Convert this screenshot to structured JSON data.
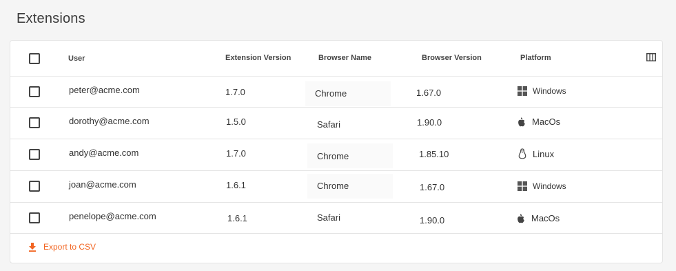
{
  "page": {
    "title": "Extensions"
  },
  "table": {
    "columns": {
      "user": "User",
      "extension_version": "Extension Version",
      "browser_name": "Browser Name",
      "browser_version": "Browser Version",
      "platform": "Platform"
    },
    "rows": [
      {
        "user": "peter@acme.com",
        "extension_version": "1.7.0",
        "browser_name": "Chrome",
        "browser_version": "1.67.0",
        "platform": "Windows",
        "platform_icon": "windows-icon"
      },
      {
        "user": "dorothy@acme.com",
        "extension_version": "1.5.0",
        "browser_name": "Safari",
        "browser_version": "1.90.0",
        "platform": "MacOs",
        "platform_icon": "apple-icon"
      },
      {
        "user": "andy@acme.com",
        "extension_version": "1.7.0",
        "browser_name": "Chrome",
        "browser_version": "1.85.10",
        "platform": "Linux",
        "platform_icon": "linux-icon"
      },
      {
        "user": "joan@acme.com",
        "extension_version": "1.6.1",
        "browser_name": "Chrome",
        "browser_version": "1.67.0",
        "platform": "Windows",
        "platform_icon": "windows-icon"
      },
      {
        "user": "penelope@acme.com",
        "extension_version": "1.6.1",
        "browser_name": "Safari",
        "browser_version": "1.90.0",
        "platform": "MacOs",
        "platform_icon": "apple-icon"
      }
    ]
  },
  "footer": {
    "export_label": "Export to CSV",
    "export_icon": "download-icon"
  },
  "colors": {
    "accent": "#f26522",
    "border": "#e4e4e4",
    "background": "#f5f5f5"
  }
}
